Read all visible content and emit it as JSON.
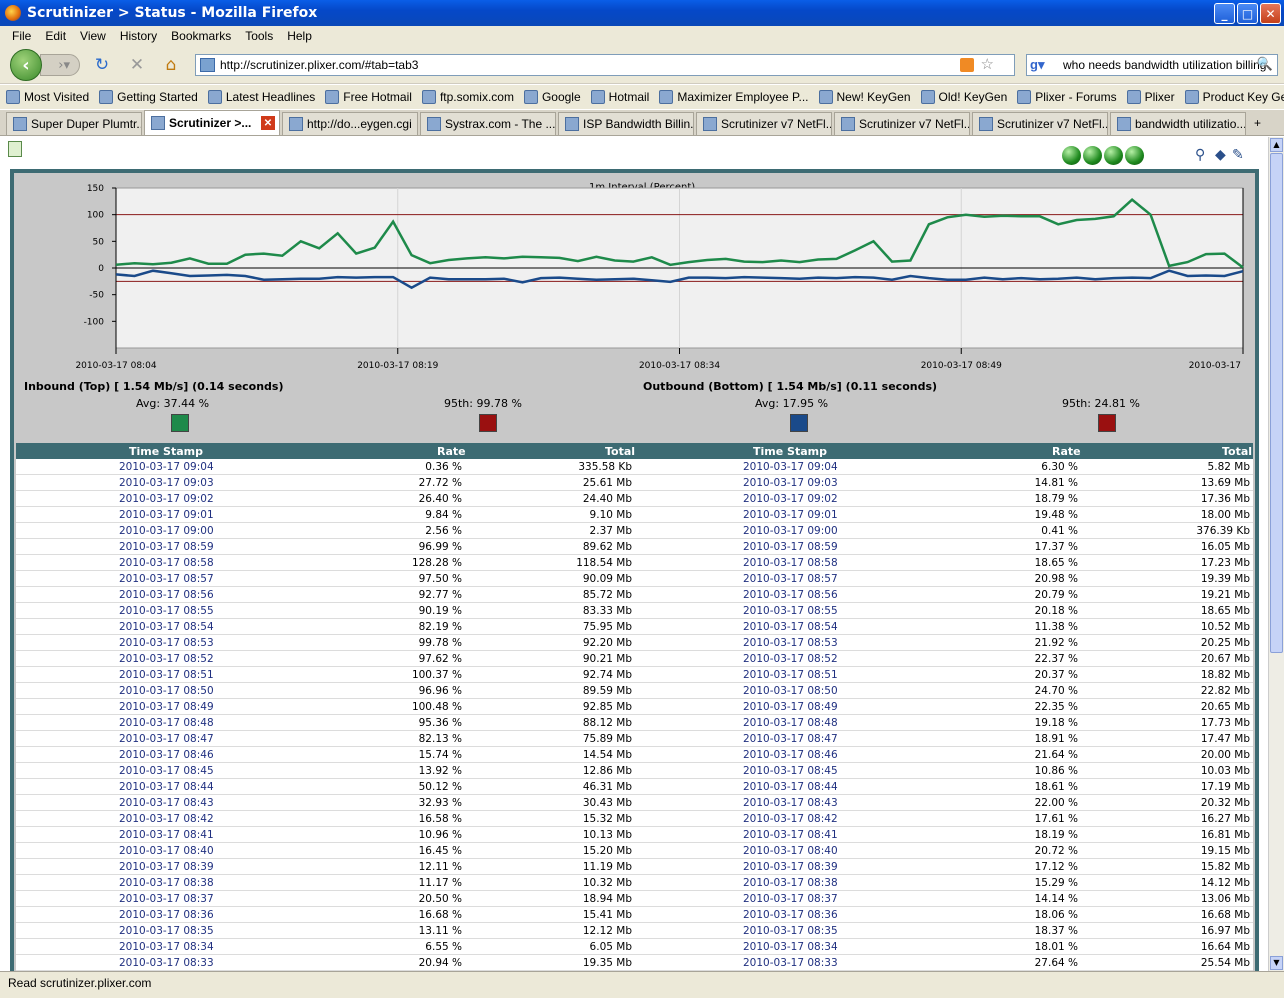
{
  "window": {
    "title": "Scrutinizer > Status - Mozilla Firefox"
  },
  "menu": [
    "File",
    "Edit",
    "View",
    "History",
    "Bookmarks",
    "Tools",
    "Help"
  ],
  "nav": {
    "url": "http://scrutinizer.plixer.com/#tab=tab3",
    "search": "who needs bandwidth utilization billing"
  },
  "bookmarks": [
    "Most Visited",
    "Getting Started",
    "Latest Headlines",
    "Free Hotmail",
    "ftp.somix.com",
    "Google",
    "Hotmail",
    "Maximizer Employee P...",
    "New! KeyGen",
    "Old! KeyGen",
    "Plixer - Forums",
    "Plixer",
    "Product Key Generator"
  ],
  "tabs": [
    "Super Duper Plumtr...",
    "Scrutinizer >...",
    "http://do...eygen.cgi",
    "Systrax.com - The ...",
    "ISP Bandwidth Billin...",
    "Scrutinizer v7 NetFl...",
    "Scrutinizer v7 NetFl...",
    "Scrutinizer v7 NetFl...",
    "bandwidth utilizatio..."
  ],
  "status": "Read scrutinizer.plixer.com",
  "chart_data": {
    "type": "line",
    "title": "1m Interval (Percent)",
    "ylim": [
      -150,
      150
    ],
    "yticks": [
      "150",
      "100",
      "50",
      "0",
      "-50",
      "-100"
    ],
    "xticks": [
      "2010-03-17 08:04",
      "2010-03-17 08:19",
      "2010-03-17 08:34",
      "2010-03-17 08:49",
      "2010-03-17"
    ],
    "series": [
      {
        "name": "Inbound",
        "color": "#1e8a4a",
        "values": [
          6,
          9,
          7,
          10,
          18,
          8,
          8,
          25,
          27,
          23,
          50,
          37,
          65,
          27,
          38,
          87,
          24,
          9,
          15,
          18,
          20,
          18,
          21,
          20,
          19,
          13,
          21,
          14,
          12,
          20,
          6,
          11,
          15,
          17,
          12,
          11,
          14,
          11,
          16,
          17,
          33,
          50,
          12,
          14,
          82,
          95,
          100,
          96,
          98,
          97,
          97,
          82,
          90,
          92,
          97,
          128,
          100,
          4,
          11,
          26,
          27,
          1
        ]
      },
      {
        "name": "Outbound",
        "color": "#1a4a8a",
        "values": [
          -12,
          -15,
          -5,
          -10,
          -15,
          -14,
          -13,
          -15,
          -22,
          -21,
          -20,
          -20,
          -17,
          -18,
          -17,
          -17,
          -37,
          -18,
          -21,
          -21,
          -21,
          -20,
          -27,
          -19,
          -18,
          -20,
          -22,
          -21,
          -20,
          -23,
          -26,
          -18,
          -18,
          -19,
          -17,
          -18,
          -19,
          -20,
          -18,
          -19,
          -17,
          -18,
          -22,
          -15,
          -19,
          -22,
          -22,
          -18,
          -21,
          -19,
          -21,
          -20,
          -18,
          -21,
          -19,
          -18,
          -19,
          -5,
          -15,
          -14,
          -15,
          -6
        ]
      }
    ]
  },
  "inbound": {
    "label": "Inbound (Top) [ 1.54 Mb/s] (0.14 seconds)",
    "avg": "Avg: 37.44 %",
    "p95": "95th: 99.78 %"
  },
  "outbound": {
    "label": "Outbound (Bottom) [ 1.54 Mb/s] (0.11 seconds)",
    "avg": "Avg: 17.95 %",
    "p95": "95th: 24.81 %"
  },
  "colors": {
    "inbound": "#1e8a4a",
    "outbound": "#1a4a8a",
    "p95": "#9a1010",
    "limit": "#8a1a1a"
  },
  "table": {
    "headers": [
      "Time Stamp",
      "Rate",
      "Total",
      "Time Stamp",
      "Rate",
      "Total"
    ],
    "rows": [
      [
        "2010-03-17 09:04",
        "0.36 %",
        "335.58 Kb",
        "2010-03-17 09:04",
        "6.30 %",
        "5.82 Mb"
      ],
      [
        "2010-03-17 09:03",
        "27.72 %",
        "25.61 Mb",
        "2010-03-17 09:03",
        "14.81 %",
        "13.69 Mb"
      ],
      [
        "2010-03-17 09:02",
        "26.40 %",
        "24.40 Mb",
        "2010-03-17 09:02",
        "18.79 %",
        "17.36 Mb"
      ],
      [
        "2010-03-17 09:01",
        "9.84 %",
        "9.10 Mb",
        "2010-03-17 09:01",
        "19.48 %",
        "18.00 Mb"
      ],
      [
        "2010-03-17 09:00",
        "2.56 %",
        "2.37 Mb",
        "2010-03-17 09:00",
        "0.41 %",
        "376.39 Kb"
      ],
      [
        "2010-03-17 08:59",
        "96.99 %",
        "89.62 Mb",
        "2010-03-17 08:59",
        "17.37 %",
        "16.05 Mb"
      ],
      [
        "2010-03-17 08:58",
        "128.28 %",
        "118.54 Mb",
        "2010-03-17 08:58",
        "18.65 %",
        "17.23 Mb"
      ],
      [
        "2010-03-17 08:57",
        "97.50 %",
        "90.09 Mb",
        "2010-03-17 08:57",
        "20.98 %",
        "19.39 Mb"
      ],
      [
        "2010-03-17 08:56",
        "92.77 %",
        "85.72 Mb",
        "2010-03-17 08:56",
        "20.79 %",
        "19.21 Mb"
      ],
      [
        "2010-03-17 08:55",
        "90.19 %",
        "83.33 Mb",
        "2010-03-17 08:55",
        "20.18 %",
        "18.65 Mb"
      ],
      [
        "2010-03-17 08:54",
        "82.19 %",
        "75.95 Mb",
        "2010-03-17 08:54",
        "11.38 %",
        "10.52 Mb"
      ],
      [
        "2010-03-17 08:53",
        "99.78 %",
        "92.20 Mb",
        "2010-03-17 08:53",
        "21.92 %",
        "20.25 Mb"
      ],
      [
        "2010-03-17 08:52",
        "97.62 %",
        "90.21 Mb",
        "2010-03-17 08:52",
        "22.37 %",
        "20.67 Mb"
      ],
      [
        "2010-03-17 08:51",
        "100.37 %",
        "92.74 Mb",
        "2010-03-17 08:51",
        "20.37 %",
        "18.82 Mb"
      ],
      [
        "2010-03-17 08:50",
        "96.96 %",
        "89.59 Mb",
        "2010-03-17 08:50",
        "24.70 %",
        "22.82 Mb"
      ],
      [
        "2010-03-17 08:49",
        "100.48 %",
        "92.85 Mb",
        "2010-03-17 08:49",
        "22.35 %",
        "20.65 Mb"
      ],
      [
        "2010-03-17 08:48",
        "95.36 %",
        "88.12 Mb",
        "2010-03-17 08:48",
        "19.18 %",
        "17.73 Mb"
      ],
      [
        "2010-03-17 08:47",
        "82.13 %",
        "75.89 Mb",
        "2010-03-17 08:47",
        "18.91 %",
        "17.47 Mb"
      ],
      [
        "2010-03-17 08:46",
        "15.74 %",
        "14.54 Mb",
        "2010-03-17 08:46",
        "21.64 %",
        "20.00 Mb"
      ],
      [
        "2010-03-17 08:45",
        "13.92 %",
        "12.86 Mb",
        "2010-03-17 08:45",
        "10.86 %",
        "10.03 Mb"
      ],
      [
        "2010-03-17 08:44",
        "50.12 %",
        "46.31 Mb",
        "2010-03-17 08:44",
        "18.61 %",
        "17.19 Mb"
      ],
      [
        "2010-03-17 08:43",
        "32.93 %",
        "30.43 Mb",
        "2010-03-17 08:43",
        "22.00 %",
        "20.32 Mb"
      ],
      [
        "2010-03-17 08:42",
        "16.58 %",
        "15.32 Mb",
        "2010-03-17 08:42",
        "17.61 %",
        "16.27 Mb"
      ],
      [
        "2010-03-17 08:41",
        "10.96 %",
        "10.13 Mb",
        "2010-03-17 08:41",
        "18.19 %",
        "16.81 Mb"
      ],
      [
        "2010-03-17 08:40",
        "16.45 %",
        "15.20 Mb",
        "2010-03-17 08:40",
        "20.72 %",
        "19.15 Mb"
      ],
      [
        "2010-03-17 08:39",
        "12.11 %",
        "11.19 Mb",
        "2010-03-17 08:39",
        "17.12 %",
        "15.82 Mb"
      ],
      [
        "2010-03-17 08:38",
        "11.17 %",
        "10.32 Mb",
        "2010-03-17 08:38",
        "15.29 %",
        "14.12 Mb"
      ],
      [
        "2010-03-17 08:37",
        "20.50 %",
        "18.94 Mb",
        "2010-03-17 08:37",
        "14.14 %",
        "13.06 Mb"
      ],
      [
        "2010-03-17 08:36",
        "16.68 %",
        "15.41 Mb",
        "2010-03-17 08:36",
        "18.06 %",
        "16.68 Mb"
      ],
      [
        "2010-03-17 08:35",
        "13.11 %",
        "12.12 Mb",
        "2010-03-17 08:35",
        "18.37 %",
        "16.97 Mb"
      ],
      [
        "2010-03-17 08:34",
        "6.55 %",
        "6.05 Mb",
        "2010-03-17 08:34",
        "18.01 %",
        "16.64 Mb"
      ],
      [
        "2010-03-17 08:33",
        "20.94 %",
        "19.35 Mb",
        "2010-03-17 08:33",
        "27.64 %",
        "25.54 Mb"
      ]
    ]
  }
}
